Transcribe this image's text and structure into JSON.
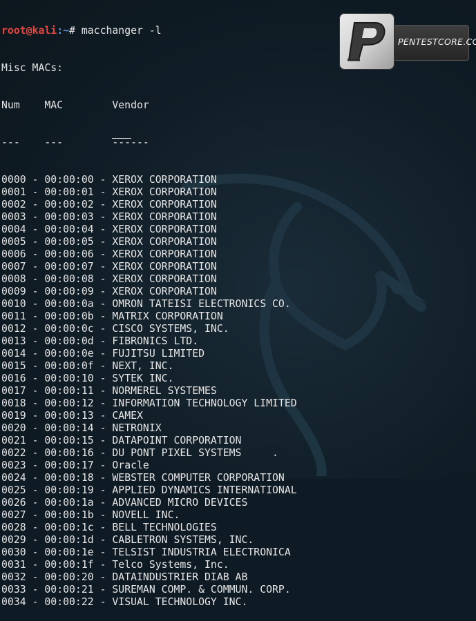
{
  "prompt": {
    "user_host": "root@kali",
    "path": ":~",
    "symbol": "# ",
    "command": "macchanger -l"
  },
  "header_lines": [
    "Misc MACs:",
    "Num    MAC        Vendor",
    "---    ---        ------"
  ],
  "rows": [
    {
      "num": "0000",
      "mac": "00:00:00",
      "vendor": "XEROX CORPORATION"
    },
    {
      "num": "0001",
      "mac": "00:00:01",
      "vendor": "XEROX CORPORATION"
    },
    {
      "num": "0002",
      "mac": "00:00:02",
      "vendor": "XEROX CORPORATION"
    },
    {
      "num": "0003",
      "mac": "00:00:03",
      "vendor": "XEROX CORPORATION"
    },
    {
      "num": "0004",
      "mac": "00:00:04",
      "vendor": "XEROX CORPORATION"
    },
    {
      "num": "0005",
      "mac": "00:00:05",
      "vendor": "XEROX CORPORATION"
    },
    {
      "num": "0006",
      "mac": "00:00:06",
      "vendor": "XEROX CORPORATION"
    },
    {
      "num": "0007",
      "mac": "00:00:07",
      "vendor": "XEROX CORPORATION"
    },
    {
      "num": "0008",
      "mac": "00:00:08",
      "vendor": "XEROX CORPORATION"
    },
    {
      "num": "0009",
      "mac": "00:00:09",
      "vendor": "XEROX CORPORATION"
    },
    {
      "num": "0010",
      "mac": "00:00:0a",
      "vendor": "OMRON TATEISI ELECTRONICS CO."
    },
    {
      "num": "0011",
      "mac": "00:00:0b",
      "vendor": "MATRIX CORPORATION"
    },
    {
      "num": "0012",
      "mac": "00:00:0c",
      "vendor": "CISCO SYSTEMS, INC."
    },
    {
      "num": "0013",
      "mac": "00:00:0d",
      "vendor": "FIBRONICS LTD."
    },
    {
      "num": "0014",
      "mac": "00:00:0e",
      "vendor": "FUJITSU LIMITED"
    },
    {
      "num": "0015",
      "mac": "00:00:0f",
      "vendor": "NEXT, INC."
    },
    {
      "num": "0016",
      "mac": "00:00:10",
      "vendor": "SYTEK INC."
    },
    {
      "num": "0017",
      "mac": "00:00:11",
      "vendor": "NORMEREL SYSTEMES"
    },
    {
      "num": "0018",
      "mac": "00:00:12",
      "vendor": "INFORMATION TECHNOLOGY LIMITED"
    },
    {
      "num": "0019",
      "mac": "00:00:13",
      "vendor": "CAMEX"
    },
    {
      "num": "0020",
      "mac": "00:00:14",
      "vendor": "NETRONIX"
    },
    {
      "num": "0021",
      "mac": "00:00:15",
      "vendor": "DATAPOINT CORPORATION"
    },
    {
      "num": "0022",
      "mac": "00:00:16",
      "vendor": "DU PONT PIXEL SYSTEMS     ."
    },
    {
      "num": "0023",
      "mac": "00:00:17",
      "vendor": "Oracle"
    },
    {
      "num": "0024",
      "mac": "00:00:18",
      "vendor": "WEBSTER COMPUTER CORPORATION"
    },
    {
      "num": "0025",
      "mac": "00:00:19",
      "vendor": "APPLIED DYNAMICS INTERNATIONAL"
    },
    {
      "num": "0026",
      "mac": "00:00:1a",
      "vendor": "ADVANCED MICRO DEVICES"
    },
    {
      "num": "0027",
      "mac": "00:00:1b",
      "vendor": "NOVELL INC."
    },
    {
      "num": "0028",
      "mac": "00:00:1c",
      "vendor": "BELL TECHNOLOGIES"
    },
    {
      "num": "0029",
      "mac": "00:00:1d",
      "vendor": "CABLETRON SYSTEMS, INC."
    },
    {
      "num": "0030",
      "mac": "00:00:1e",
      "vendor": "TELSIST INDUSTRIA ELECTRONICA"
    },
    {
      "num": "0031",
      "mac": "00:00:1f",
      "vendor": "Telco Systems, Inc."
    },
    {
      "num": "0032",
      "mac": "00:00:20",
      "vendor": "DATAINDUSTRIER DIAB AB"
    },
    {
      "num": "0033",
      "mac": "00:00:21",
      "vendor": "SUREMAN COMP. & COMMUN. CORP."
    },
    {
      "num": "0034",
      "mac": "00:00:22",
      "vendor": "VISUAL TECHNOLOGY INC."
    }
  ],
  "watermark": {
    "logo_letter": "P",
    "logo_text": "PENTESTCORE.COM"
  },
  "colors": {
    "background": "#0f1b24",
    "text": "#e6e6e6",
    "prompt_user": "#e8463f",
    "prompt_path": "#5f8fd8"
  }
}
